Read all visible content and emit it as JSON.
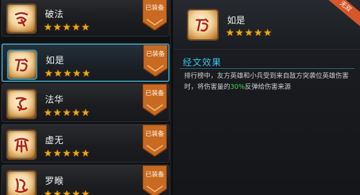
{
  "badge_label": "已装备",
  "stars": "★★★★★",
  "list": [
    {
      "name": "破法",
      "icon": "rune-pofa-icon"
    },
    {
      "name": "如是",
      "icon": "rune-rushi-icon"
    },
    {
      "name": "法华",
      "icon": "rune-fahua-icon"
    },
    {
      "name": "虚无",
      "icon": "rune-xuwu-icon"
    },
    {
      "name": "罗睺",
      "icon": "rune-luohou-icon"
    }
  ],
  "detail": {
    "name": "如是",
    "ribbon": "无双",
    "section_title": "经文效果",
    "desc_part1": "排行榜中，友方英雄和小兵受到来自敌方突袭位英雄伤害时，将伤害量的",
    "desc_highlight": "30%",
    "desc_part2": "反弹给伤害来源"
  },
  "colors": {
    "accent": "#38c3ee",
    "star": "#f0a81a",
    "highlight": "#39d34a",
    "badge": "#c86a22"
  }
}
